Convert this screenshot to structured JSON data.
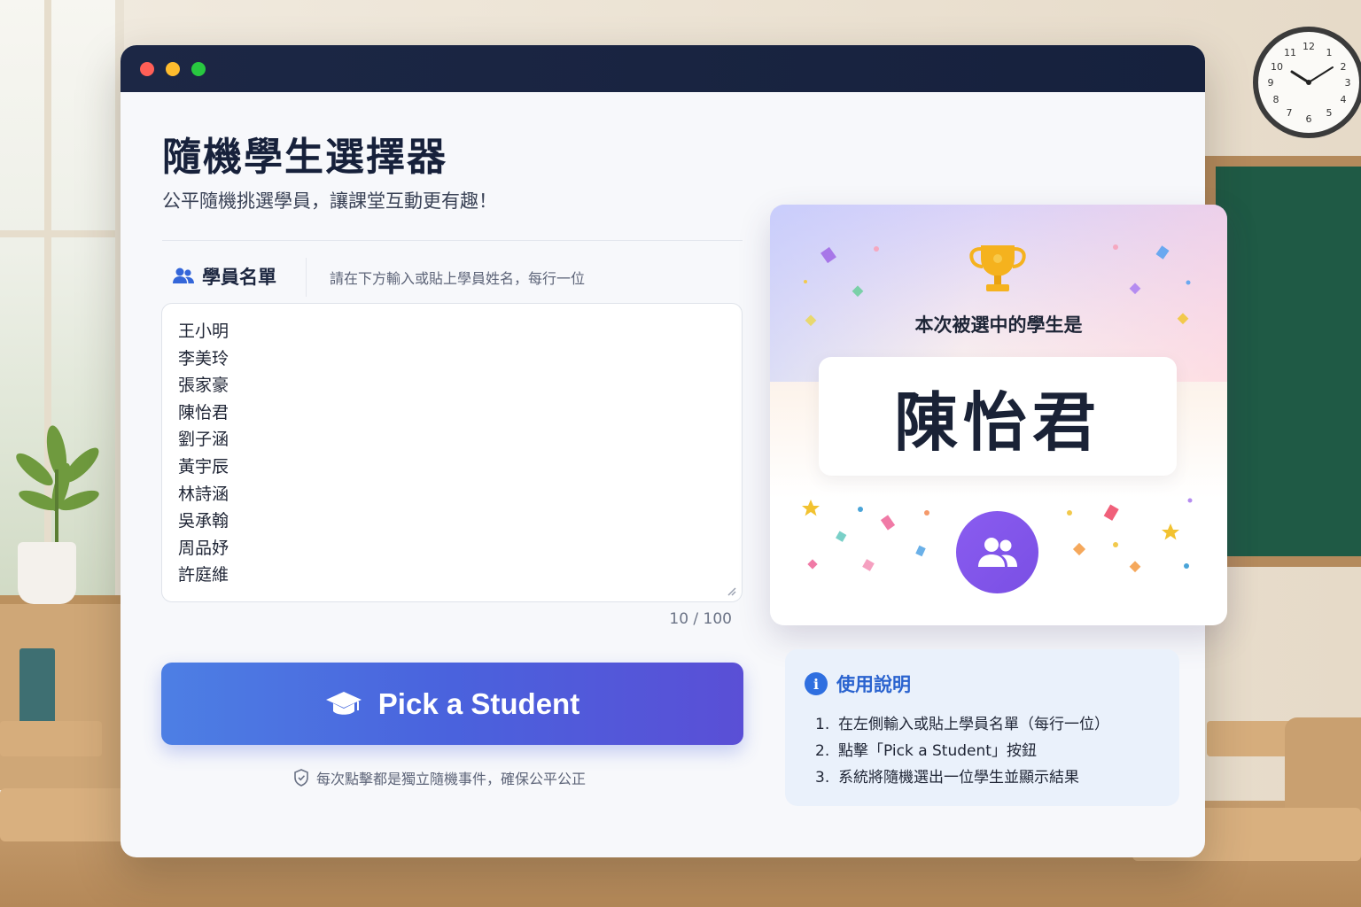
{
  "window": {
    "controls": [
      "close",
      "minimize",
      "maximize"
    ]
  },
  "header": {
    "title": "隨機學生選擇器",
    "subtitle": "公平隨機挑選學員，讓課堂互動更有趣！"
  },
  "roster": {
    "label": "學員名單",
    "icon": "users-icon",
    "hint": "請在下方輸入或貼上學員姓名，每行一位",
    "names": [
      "王小明",
      "李美玲",
      "張家豪",
      "陳怡君",
      "劉子涵",
      "黃宇辰",
      "林詩涵",
      "吳承翰",
      "周品妤",
      "許庭維"
    ],
    "counter": "10 / 100"
  },
  "pick_button": {
    "label": "Pick a Student",
    "icon": "graduation-cap-icon"
  },
  "fair_note": {
    "text": "每次點擊都是獨立隨機事件，確保公平公正",
    "icon": "shield-icon"
  },
  "result": {
    "label": "本次被選中的學生是",
    "name": "陳怡君",
    "trophy_icon": "trophy-icon",
    "avatar_icon": "users-icon"
  },
  "instructions": {
    "title": "使用說明",
    "icon": "info-icon",
    "steps": [
      {
        "num": "1.",
        "text": "在左側輸入或貼上學員名單（每行一位）"
      },
      {
        "num": "2.",
        "text": "點擊「Pick a Student」按鈕"
      },
      {
        "num": "3.",
        "text": "系統將隨機選出一位學生並顯示結果"
      }
    ]
  },
  "colors": {
    "accent_blue": "#4a62dd",
    "accent_purple": "#7a4fe4",
    "titlebar": "#1c2745",
    "title_text": "#17213b",
    "info_blue": "#2f6fe0"
  }
}
